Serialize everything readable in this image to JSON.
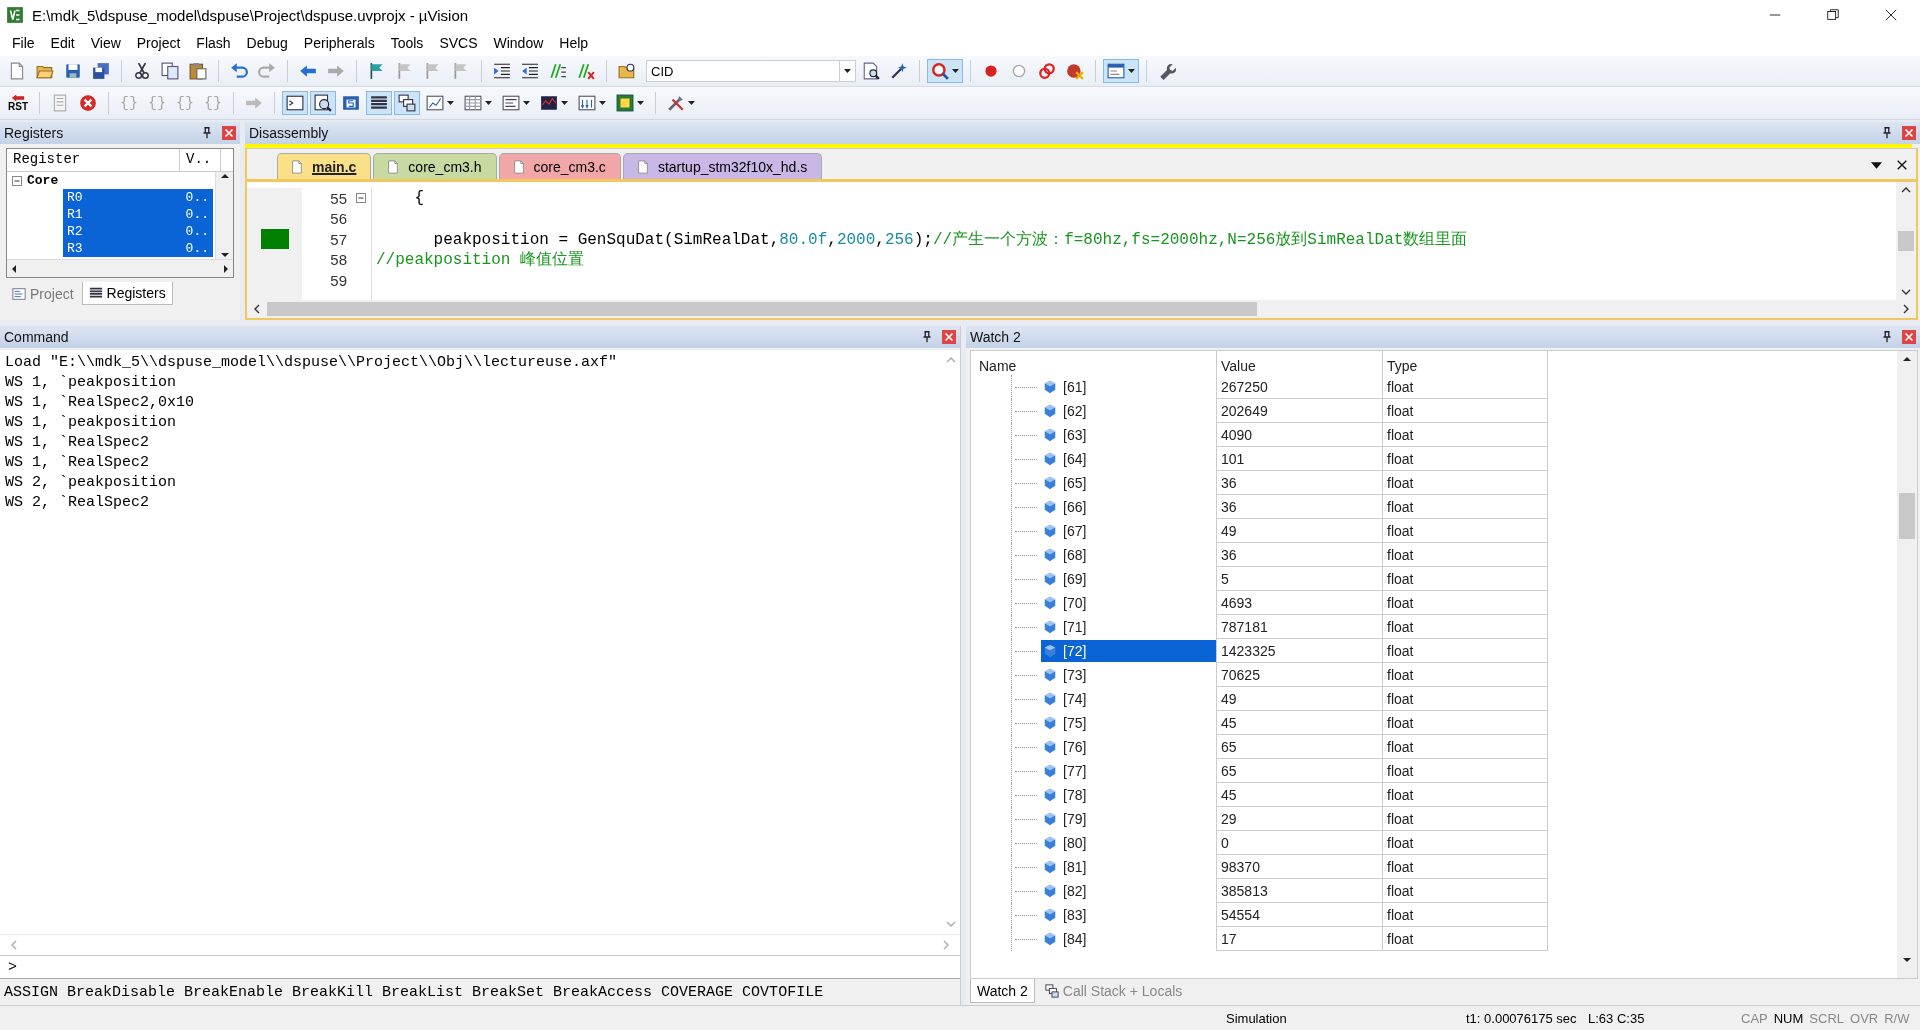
{
  "window": {
    "title": "E:\\mdk_5\\dspuse_model\\dspuse\\Project\\dspuse.uvprojx - µVision"
  },
  "menu": [
    "File",
    "Edit",
    "View",
    "Project",
    "Flash",
    "Debug",
    "Peripherals",
    "Tools",
    "SVCS",
    "Window",
    "Help"
  ],
  "toolbar_1": {
    "find_box": {
      "value": "CID"
    },
    "debug_session": {
      "pressed": true
    },
    "window_view": {
      "pressed": true
    }
  },
  "toolbar_2": {
    "reset_button": {
      "label": "RST"
    },
    "step_buttons": [
      {
        "label": "{}",
        "disabled": true
      },
      {
        "label": "{}",
        "disabled": true
      },
      {
        "label": "{}",
        "disabled": true
      },
      {
        "label": "{}",
        "disabled": true
      }
    ],
    "view_toggles": [
      {
        "pressed": true
      },
      {
        "pressed": true
      },
      {
        "pressed": false
      },
      {
        "pressed": true
      },
      {
        "pressed": true
      }
    ]
  },
  "registers_panel": {
    "title": "Registers",
    "columns": [
      "Register",
      "V.."
    ],
    "tree": [
      {
        "name": "Core",
        "expanded": true,
        "children": [
          {
            "name": "R0",
            "value": "0..",
            "selected": true
          },
          {
            "name": "R1",
            "value": "0..",
            "selected": true
          },
          {
            "name": "R2",
            "value": "0..",
            "selected": true
          },
          {
            "name": "R3",
            "value": "0..",
            "selected": true
          }
        ]
      }
    ],
    "tabs": [
      {
        "label": "Project",
        "selected": false
      },
      {
        "label": "Registers",
        "selected": true
      }
    ]
  },
  "disassembly_panel": {
    "title": "Disassembly"
  },
  "editor": {
    "tabs": [
      {
        "label": "main.c",
        "selected": true,
        "color": "#fbe08a"
      },
      {
        "label": "core_cm3.h",
        "selected": false,
        "color": "#c6daa2"
      },
      {
        "label": "core_cm3.c",
        "selected": false,
        "color": "#f1a7a7"
      },
      {
        "label": "startup_stm32f10x_hd.s",
        "selected": false,
        "color": "#c9b7e6"
      }
    ],
    "lines": [
      {
        "number": "55",
        "foldable": true,
        "marker": false,
        "segments": [
          {
            "kind": "code",
            "text": "    {"
          }
        ]
      },
      {
        "number": "56",
        "foldable": false,
        "marker": false
      },
      {
        "number": "57",
        "foldable": false,
        "marker": true,
        "segments": [
          {
            "kind": "code",
            "text": "      peakposition = GenSquDat(SimRealDat,"
          },
          {
            "kind": "number",
            "text": "80.0f"
          },
          {
            "kind": "code",
            "text": ","
          },
          {
            "kind": "number",
            "text": "2000"
          },
          {
            "kind": "code",
            "text": ","
          },
          {
            "kind": "number",
            "text": "256"
          },
          {
            "kind": "code",
            "text": ");"
          },
          {
            "kind": "comment",
            "text": "//产生一个方波：f=80hz,fs=2000hz,N=256放到SimRealDat数组里面"
          }
        ]
      },
      {
        "number": "58",
        "foldable": false,
        "marker": false,
        "segments": [
          {
            "kind": "comment",
            "text": "//peakposition 峰值位置"
          }
        ]
      },
      {
        "number": "59",
        "foldable": false,
        "marker": false
      }
    ]
  },
  "command_panel": {
    "title": "Command",
    "output": [
      "Load \"E:\\\\mdk_5\\\\dspuse_model\\\\dspuse\\\\Project\\\\Obj\\\\lectureuse.axf\"",
      "WS 1, `peakposition",
      "WS 1, `RealSpec2,0x10",
      "WS 1, `peakposition",
      "WS 1, `RealSpec2",
      "WS 1, `RealSpec2",
      "WS 2, `peakposition",
      "WS 2, `RealSpec2"
    ],
    "prompt": ">",
    "hint": "ASSIGN BreakDisable BreakEnable BreakKill BreakList BreakSet BreakAccess COVERAGE COVTOFILE"
  },
  "watch_panel": {
    "title": "Watch 2",
    "columns": [
      "Name",
      "Value",
      "Type"
    ],
    "rows": [
      {
        "name": "[61]",
        "value": "267250",
        "type": "float",
        "selected": false
      },
      {
        "name": "[62]",
        "value": "202649",
        "type": "float",
        "selected": false
      },
      {
        "name": "[63]",
        "value": "4090",
        "type": "float",
        "selected": false
      },
      {
        "name": "[64]",
        "value": "101",
        "type": "float",
        "selected": false
      },
      {
        "name": "[65]",
        "value": "36",
        "type": "float",
        "selected": false
      },
      {
        "name": "[66]",
        "value": "36",
        "type": "float",
        "selected": false
      },
      {
        "name": "[67]",
        "value": "49",
        "type": "float",
        "selected": false
      },
      {
        "name": "[68]",
        "value": "36",
        "type": "float",
        "selected": false
      },
      {
        "name": "[69]",
        "value": "5",
        "type": "float",
        "selected": false
      },
      {
        "name": "[70]",
        "value": "4693",
        "type": "float",
        "selected": false
      },
      {
        "name": "[71]",
        "value": "787181",
        "type": "float",
        "selected": false
      },
      {
        "name": "[72]",
        "value": "1423325",
        "type": "float",
        "selected": true
      },
      {
        "name": "[73]",
        "value": "70625",
        "type": "float",
        "selected": false
      },
      {
        "name": "[74]",
        "value": "49",
        "type": "float",
        "selected": false
      },
      {
        "name": "[75]",
        "value": "45",
        "type": "float",
        "selected": false
      },
      {
        "name": "[76]",
        "value": "65",
        "type": "float",
        "selected": false
      },
      {
        "name": "[77]",
        "value": "65",
        "type": "float",
        "selected": false
      },
      {
        "name": "[78]",
        "value": "45",
        "type": "float",
        "selected": false
      },
      {
        "name": "[79]",
        "value": "29",
        "type": "float",
        "selected": false
      },
      {
        "name": "[80]",
        "value": "0",
        "type": "float",
        "selected": false
      },
      {
        "name": "[81]",
        "value": "98370",
        "type": "float",
        "selected": false
      },
      {
        "name": "[82]",
        "value": "385813",
        "type": "float",
        "selected": false
      },
      {
        "name": "[83]",
        "value": "54554",
        "type": "float",
        "selected": false
      },
      {
        "name": "[84]",
        "value": "17",
        "type": "float",
        "selected": false
      }
    ],
    "tabs": [
      {
        "label": "Watch 2",
        "selected": true
      },
      {
        "label": "Call Stack + Locals",
        "selected": false
      }
    ]
  },
  "status_bar": {
    "mode": "Simulation",
    "time": "t1: 0.00076175 sec",
    "position": "L:63 C:35",
    "indicators": [
      {
        "label": "CAP",
        "on": false
      },
      {
        "label": "NUM",
        "on": true
      },
      {
        "label": "SCRL",
        "on": false
      },
      {
        "label": "OVR",
        "on": false
      },
      {
        "label": "R/W",
        "on": false
      }
    ]
  }
}
